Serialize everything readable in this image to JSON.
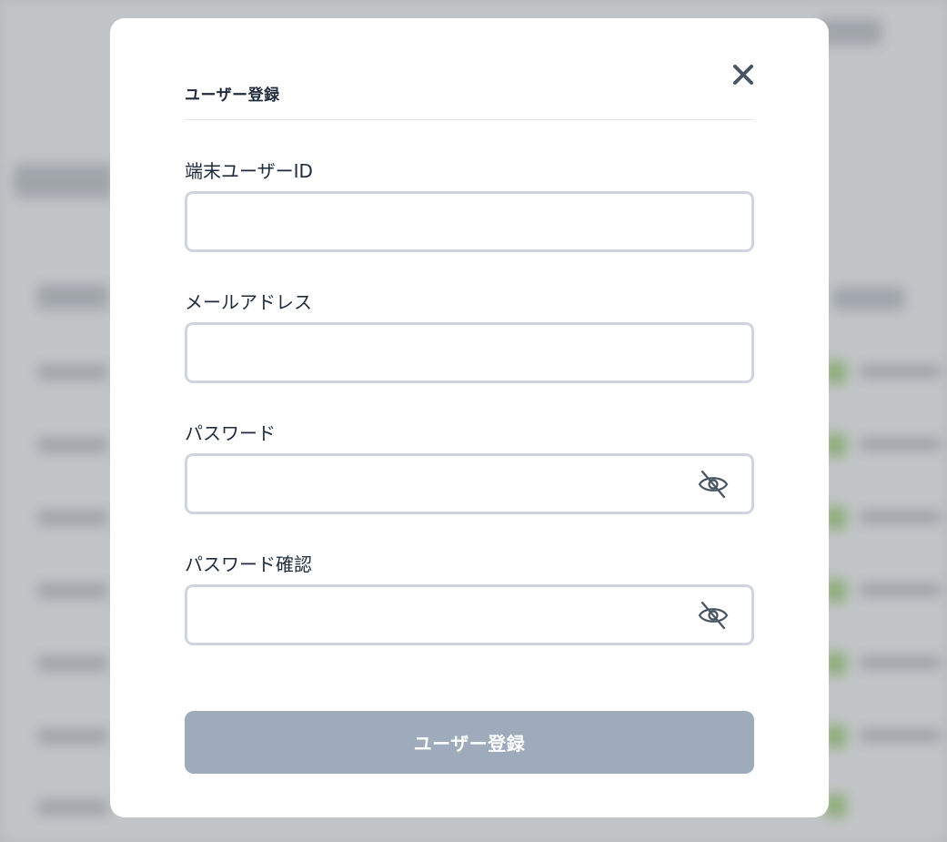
{
  "modal": {
    "title": "ユーザー登録",
    "close_icon": "close-icon"
  },
  "form": {
    "terminal_user_id": {
      "label": "端末ユーザーID",
      "value": "",
      "placeholder": ""
    },
    "email": {
      "label": "メールアドレス",
      "value": "",
      "placeholder": ""
    },
    "password": {
      "label": "パスワード",
      "value": "",
      "placeholder": "",
      "toggle_icon": "eye-off-icon"
    },
    "password_confirm": {
      "label": "パスワード確認",
      "value": "",
      "placeholder": "",
      "toggle_icon": "eye-off-icon"
    },
    "submit_label": "ユーザー登録"
  },
  "colors": {
    "title_text": "#1e2b3c",
    "input_border": "#ced5de",
    "button_disabled": "#9eabbb",
    "icon_gray": "#4a5563"
  }
}
